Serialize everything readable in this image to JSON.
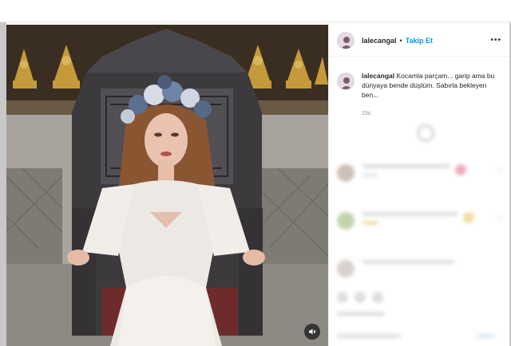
{
  "post": {
    "username": "lalecangal",
    "follow_label": "Takip Et",
    "separator": "•",
    "more_label": "•••",
    "caption_user": "lalecangal",
    "caption_text": "Kocamla parçam... garip ama bu dünyaya bende düştüm. Sabırla bekleyen ben...",
    "timestamp": "23s"
  },
  "media": {
    "mute_icon": "speaker-muted-icon"
  },
  "colors": {
    "accent": "#0095f6",
    "text": "#262626",
    "muted": "#8e8e8e"
  }
}
